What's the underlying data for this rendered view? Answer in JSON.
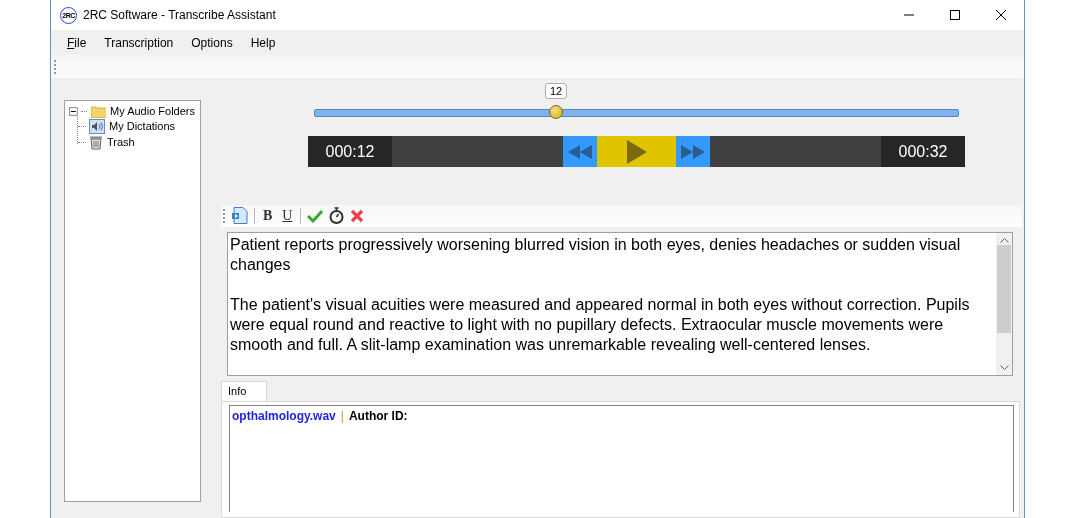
{
  "window": {
    "title": "2RC Software - Transcribe Assistant",
    "logo": "2RC"
  },
  "menu": [
    {
      "label": "File",
      "mnemonic": true
    },
    {
      "label": "Transcription",
      "mnemonic": false
    },
    {
      "label": "Options",
      "mnemonic": false
    },
    {
      "label": "Help",
      "mnemonic": false
    }
  ],
  "tree": [
    {
      "label": "My Audio Folders",
      "expanded": true,
      "children": [
        {
          "label": "My Dictations"
        },
        {
          "label": "Trash"
        }
      ]
    }
  ],
  "slider": {
    "level": 0.375,
    "tooltip": "12"
  },
  "player": {
    "elapsed": "000:12",
    "total": "000:32"
  },
  "editor_toolbar": {
    "bold": "B",
    "underline": "U"
  },
  "document": {
    "paragraphs": [
      "Patient reports progressively worsening blurred vision in both eyes, denies headaches or sudden visual changes",
      "The patient's visual acuities were measured and appeared normal in both eyes without correction. Pupils were equal round and reactive to light with no pupillary defects. Extraocular muscle movements were smooth and full. A slit-lamp examination was unremarkable revealing well-centered lenses."
    ]
  },
  "tabs": [
    {
      "label": "Info",
      "selected": true
    }
  ],
  "info": {
    "filename": "opthalmology.wav",
    "separator": "|",
    "author_label": "Author ID:"
  }
}
